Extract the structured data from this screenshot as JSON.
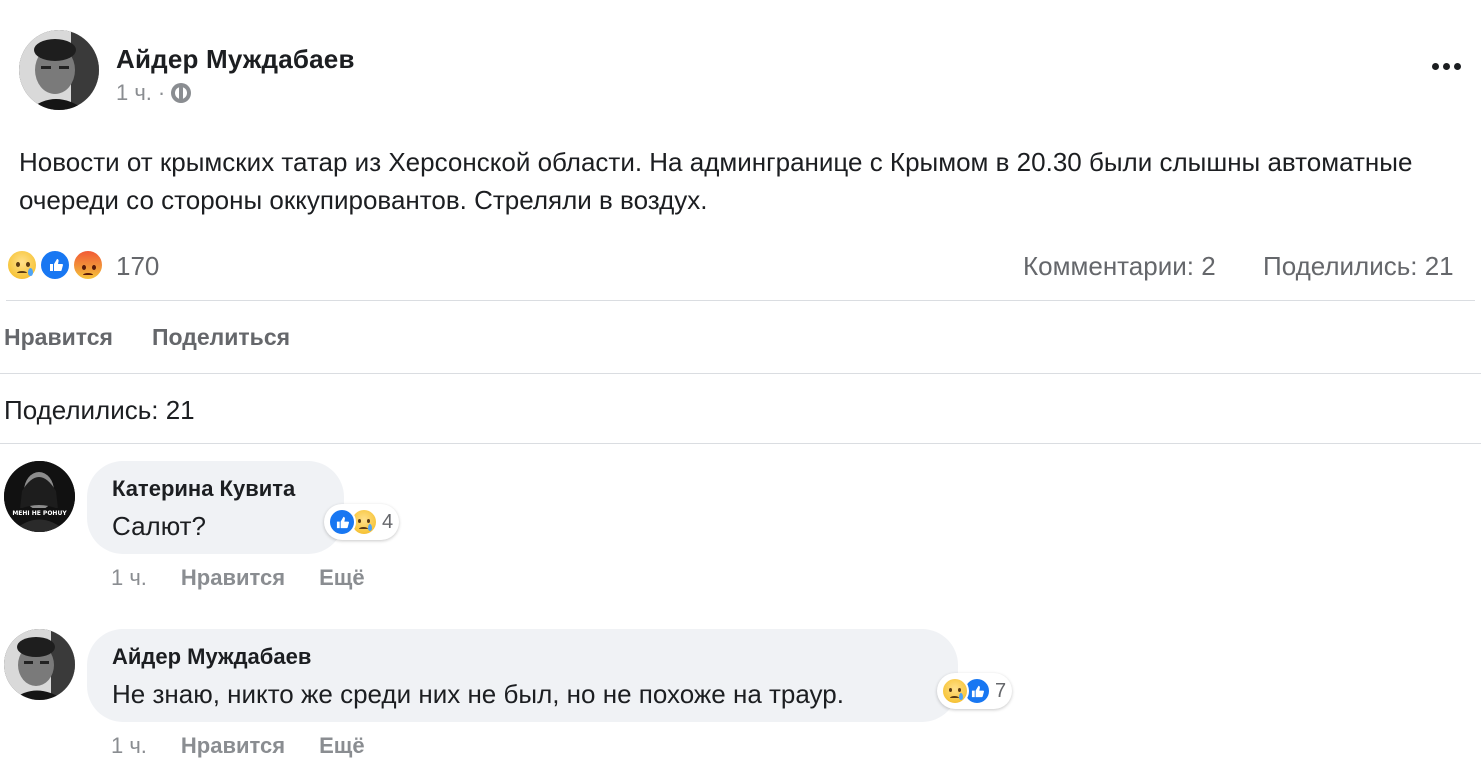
{
  "post": {
    "author": "Айдер Муждабаев",
    "time": "1 ч.",
    "separator": "·",
    "privacy_icon": "globe-icon",
    "menu_icon": "more-dots-icon",
    "text": "Новости от крымских татар из Херсонской области. На админгранице с Крымом в 20.30 были слышны автоматные очереди со стороны оккупировантов. Стреляли в воздух."
  },
  "stats": {
    "reactions": [
      "sad",
      "like",
      "angry"
    ],
    "reactions_count": "170",
    "comments": "Комментарии: 2",
    "shares": "Поделились: 21"
  },
  "actions": {
    "like": "Нравится",
    "share": "Поделиться"
  },
  "shared_section": {
    "label": "Поделились: 21"
  },
  "comments": [
    {
      "author": "Катерина Кувита",
      "avatar_caption": "МЕНІ НЕ POHUY",
      "text": "Салют?",
      "reactions": [
        "like",
        "sad"
      ],
      "reactions_count": "4",
      "time": "1 ч.",
      "like_label": "Нравится",
      "more_label": "Ещё"
    },
    {
      "author": "Айдер Муждабаев",
      "text": "Не знаю, никто же среди них не был, но не похоже на траур.",
      "reactions": [
        "sad",
        "like"
      ],
      "reactions_count": "7",
      "time": "1 ч.",
      "like_label": "Нравится",
      "more_label": "Ещё"
    }
  ],
  "colors": {
    "text_primary": "#1c1e21",
    "text_secondary": "#65676b",
    "text_meta": "#8a8d91",
    "bubble_bg": "#f0f2f5",
    "divider": "#dadde1",
    "like_blue": "#1877f2"
  }
}
